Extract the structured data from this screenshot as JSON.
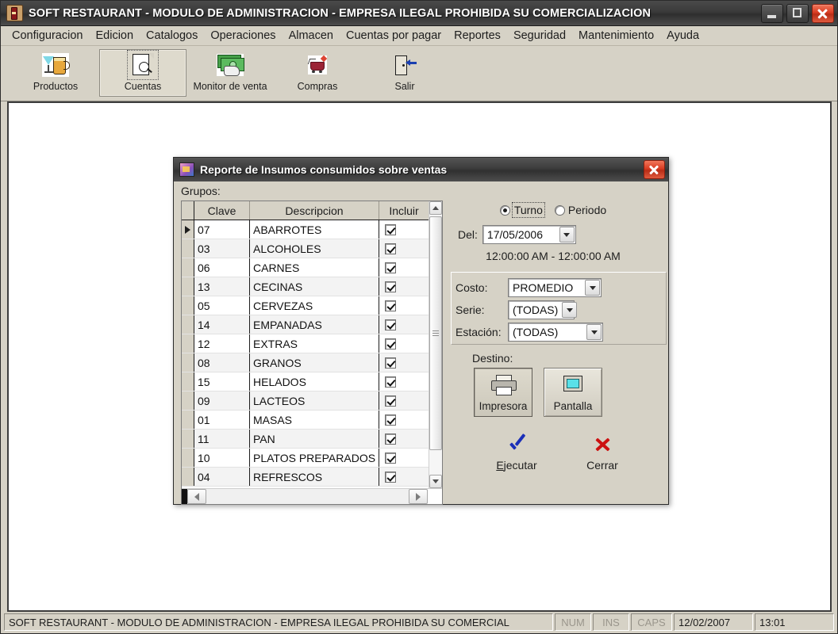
{
  "window": {
    "title": "SOFT RESTAURANT  -  MODULO DE ADMINISTRACION - EMPRESA ILEGAL PROHIBIDA SU COMERCIALIZACION",
    "icon": "app-bottle-icon",
    "buttons": {
      "minimize": "minimize-icon",
      "maximize": "maximize-icon",
      "close": "close-icon"
    }
  },
  "menubar": {
    "items": [
      {
        "label": "Configuracion"
      },
      {
        "label": "Edicion"
      },
      {
        "label": "Catalogos"
      },
      {
        "label": "Operaciones"
      },
      {
        "label": "Almacen"
      },
      {
        "label": "Cuentas por pagar"
      },
      {
        "label": "Reportes"
      },
      {
        "label": "Seguridad"
      },
      {
        "label": "Mantenimiento"
      },
      {
        "label": "Ayuda"
      }
    ]
  },
  "toolbar": {
    "buttons": [
      {
        "label": "Productos",
        "icon": "cocktail-beer-icon",
        "active": false
      },
      {
        "label": "Cuentas",
        "icon": "document-search-icon",
        "active": true
      },
      {
        "label": "Monitor de venta",
        "icon": "money-hand-icon",
        "active": false
      },
      {
        "label": "Compras",
        "icon": "shopping-cart-icon",
        "active": false
      },
      {
        "label": "Salir",
        "icon": "exit-door-icon",
        "active": false
      }
    ]
  },
  "dialog": {
    "title": "Reporte de Insumos consumidos sobre ventas",
    "icon": "windows-report-icon",
    "close_label": "close-icon",
    "grupos_label": "Grupos:",
    "grid": {
      "columns": [
        "Clave",
        "Descripcion",
        "Incluir"
      ],
      "rows": [
        {
          "clave": "07",
          "descripcion": "ABARROTES",
          "incluir": true,
          "current": true
        },
        {
          "clave": "03",
          "descripcion": "ALCOHOLES",
          "incluir": true,
          "current": false
        },
        {
          "clave": "06",
          "descripcion": "CARNES",
          "incluir": true,
          "current": false
        },
        {
          "clave": "13",
          "descripcion": "CECINAS",
          "incluir": true,
          "current": false
        },
        {
          "clave": "05",
          "descripcion": "CERVEZAS",
          "incluir": true,
          "current": false
        },
        {
          "clave": "14",
          "descripcion": "EMPANADAS",
          "incluir": true,
          "current": false
        },
        {
          "clave": "12",
          "descripcion": "EXTRAS",
          "incluir": true,
          "current": false
        },
        {
          "clave": "08",
          "descripcion": "GRANOS",
          "incluir": true,
          "current": false
        },
        {
          "clave": "15",
          "descripcion": "HELADOS",
          "incluir": true,
          "current": false
        },
        {
          "clave": "09",
          "descripcion": "LACTEOS",
          "incluir": true,
          "current": false
        },
        {
          "clave": "01",
          "descripcion": "MASAS",
          "incluir": true,
          "current": false
        },
        {
          "clave": "11",
          "descripcion": "PAN",
          "incluir": true,
          "current": false
        },
        {
          "clave": "10",
          "descripcion": "PLATOS PREPARADOS",
          "incluir": true,
          "current": false
        },
        {
          "clave": "04",
          "descripcion": "REFRESCOS",
          "incluir": true,
          "current": false
        }
      ]
    },
    "mode": {
      "options": [
        {
          "label": "Turno",
          "selected": true,
          "focused": true
        },
        {
          "label": "Periodo",
          "selected": false,
          "focused": false
        }
      ]
    },
    "date": {
      "label": "Del:",
      "value": "17/05/2006",
      "range_text": "12:00:00 AM - 12:00:00 AM"
    },
    "options": {
      "costo": {
        "label": "Costo:",
        "value": "PROMEDIO"
      },
      "serie": {
        "label": "Serie:",
        "value": "(TODAS)"
      },
      "estacion": {
        "label": "Estación:",
        "value": "(TODAS)"
      }
    },
    "destino": {
      "label": "Destino:",
      "buttons": [
        {
          "label": "Impresora",
          "icon": "printer-icon",
          "pressed": true
        },
        {
          "label": "Pantalla",
          "icon": "monitor-icon",
          "pressed": false
        }
      ]
    },
    "actions": [
      {
        "label": "Ejecutar",
        "icon": "check-icon",
        "accel": "E"
      },
      {
        "label": "Cerrar",
        "icon": "x-icon",
        "accel": ""
      }
    ]
  },
  "statusbar": {
    "message": "SOFT RESTAURANT  -  MODULO DE ADMINISTRACION - EMPRESA ILEGAL PROHIBIDA SU COMERCIAL",
    "num": "NUM",
    "ins": "INS",
    "caps": "CAPS",
    "date": "12/02/2007",
    "time": "13:01"
  },
  "colors": {
    "face": "#d6d2c6",
    "titlebar": "#3a3a3a",
    "close_red": "#d93b22",
    "accent_blue": "#1a2fb8",
    "accent_red": "#cc1111"
  }
}
